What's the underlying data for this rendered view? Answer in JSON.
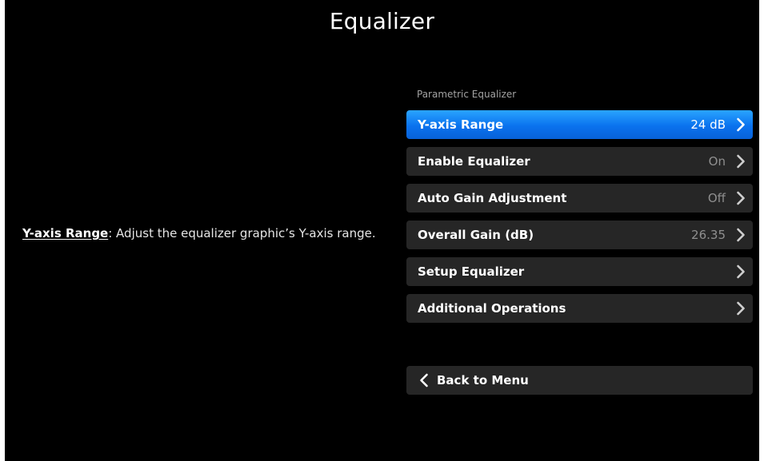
{
  "page": {
    "title": "Equalizer"
  },
  "description": {
    "term": "Y-axis Range",
    "text": ": Adjust the equalizer graphic’s Y-axis range."
  },
  "section": {
    "label": "Parametric Equalizer"
  },
  "menu": {
    "items": [
      {
        "label": "Y-axis Range",
        "value": "24 dB",
        "icon": "chevron-right-icon",
        "selected": true
      },
      {
        "label": "Enable Equalizer",
        "value": "On",
        "icon": "chevron-right-icon",
        "selected": false
      },
      {
        "label": "Auto Gain Adjustment",
        "value": "Off",
        "icon": "chevron-right-icon",
        "selected": false
      },
      {
        "label": "Overall Gain (dB)",
        "value": "26.35",
        "icon": "chevron-right-icon",
        "selected": false
      },
      {
        "label": "Setup Equalizer",
        "value": "",
        "icon": "chevron-right-icon",
        "selected": false
      },
      {
        "label": "Additional Operations",
        "value": "",
        "icon": "chevron-right-icon",
        "selected": false
      }
    ]
  },
  "back": {
    "label": "Back to Menu",
    "icon": "chevron-left-icon"
  },
  "colors": {
    "background": "#000000",
    "item_background": "#262626",
    "selected_accent": "#0a72ee",
    "value_text": "#8f8f8f"
  }
}
